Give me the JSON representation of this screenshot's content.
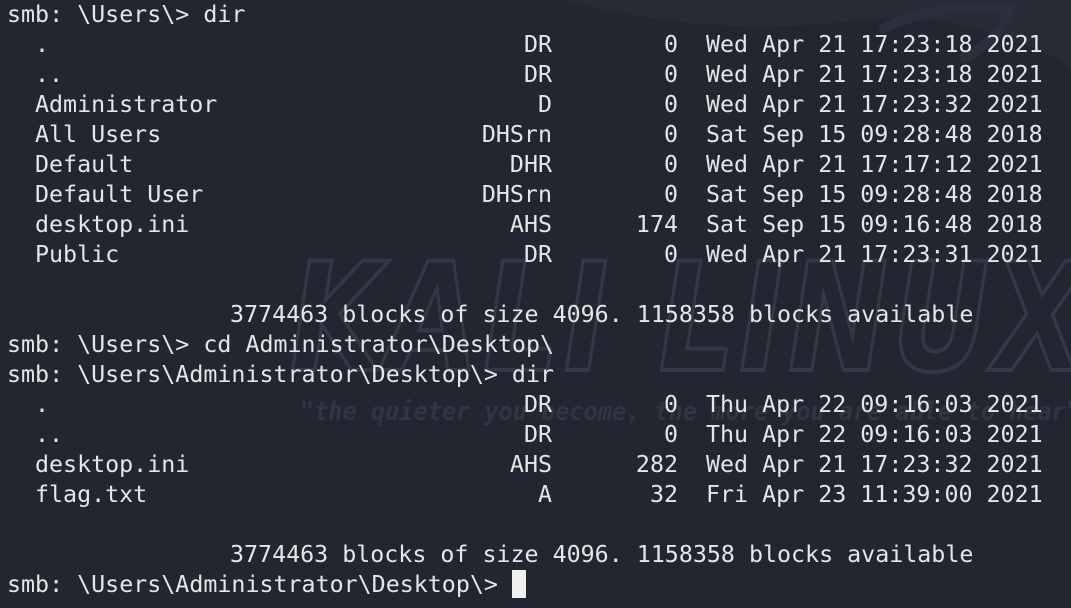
{
  "watermark": {
    "logo_text": "KALI LINUX",
    "tagline": "\"the quieter you become, the more you are able to hear\""
  },
  "session1": {
    "prompt_line": "smb: \\Users\\> dir",
    "entries": [
      {
        "name": ".",
        "attr": "DR",
        "size": "0",
        "date": "Wed Apr 21 17:23:18 2021"
      },
      {
        "name": "..",
        "attr": "DR",
        "size": "0",
        "date": "Wed Apr 21 17:23:18 2021"
      },
      {
        "name": "Administrator",
        "attr": "D",
        "size": "0",
        "date": "Wed Apr 21 17:23:32 2021"
      },
      {
        "name": "All Users",
        "attr": "DHSrn",
        "size": "0",
        "date": "Sat Sep 15 09:28:48 2018"
      },
      {
        "name": "Default",
        "attr": "DHR",
        "size": "0",
        "date": "Wed Apr 21 17:17:12 2021"
      },
      {
        "name": "Default User",
        "attr": "DHSrn",
        "size": "0",
        "date": "Sat Sep 15 09:28:48 2018"
      },
      {
        "name": "desktop.ini",
        "attr": "AHS",
        "size": "174",
        "date": "Sat Sep 15 09:16:48 2018"
      },
      {
        "name": "Public",
        "attr": "DR",
        "size": "0",
        "date": "Wed Apr 21 17:23:31 2021"
      }
    ],
    "summary": "3774463 blocks of size 4096. 1158358 blocks available"
  },
  "cd_line": "smb: \\Users\\> cd Administrator\\Desktop\\",
  "session2": {
    "prompt_line": "smb: \\Users\\Administrator\\Desktop\\> dir",
    "entries": [
      {
        "name": ".",
        "attr": "DR",
        "size": "0",
        "date": "Thu Apr 22 09:16:03 2021"
      },
      {
        "name": "..",
        "attr": "DR",
        "size": "0",
        "date": "Thu Apr 22 09:16:03 2021"
      },
      {
        "name": "desktop.ini",
        "attr": "AHS",
        "size": "282",
        "date": "Wed Apr 21 17:23:32 2021"
      },
      {
        "name": "flag.txt",
        "attr": "A",
        "size": "32",
        "date": "Fri Apr 23 11:39:00 2021"
      }
    ],
    "summary": "3774463 blocks of size 4096. 1158358 blocks available"
  },
  "final_prompt": "smb: \\Users\\Administrator\\Desktop\\> ",
  "colors": {
    "background": "#222630",
    "text": "#e6e6e6",
    "watermark": "#2c313d"
  }
}
